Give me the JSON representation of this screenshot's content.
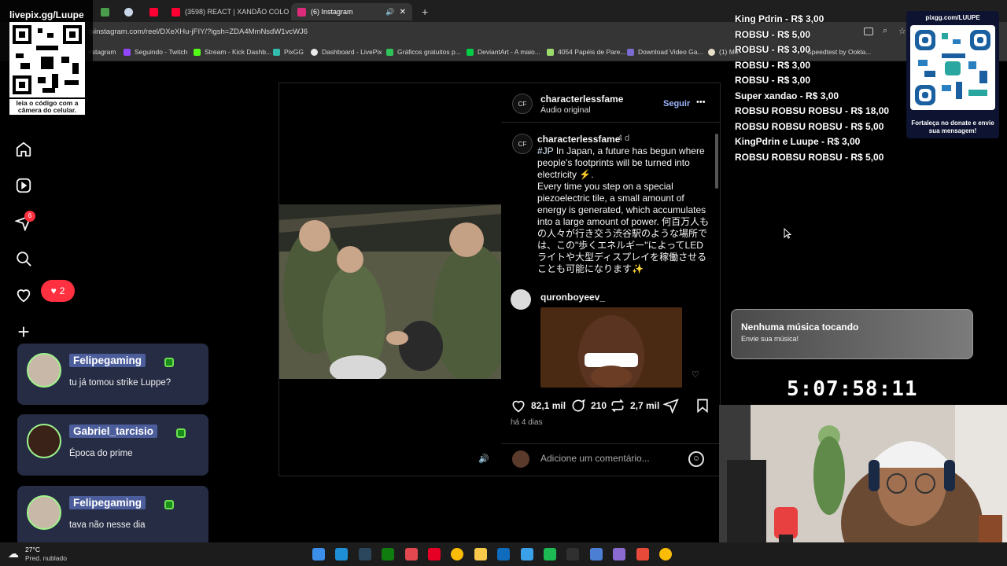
{
  "browser": {
    "tabs": [
      {
        "label": "livepix.gg/Luupe",
        "color": "#7ab8ff"
      },
      {
        "label": "",
        "color": "#4a9d4a"
      },
      {
        "label": "",
        "color": "#c8d6e8"
      },
      {
        "label": "",
        "color": "#ff0033"
      },
      {
        "label": "(3598) REACT | XANDÃO COLO",
        "color": "#ff0033"
      },
      {
        "label": "(6) Instagram",
        "color": "#dd2a7b"
      }
    ],
    "new_tab_label": "+",
    "url": "instagram.com/reel/DXeXHu-jFIY/?igsh=ZDA4MmNsdW1vcWJ6",
    "bookmarks": [
      {
        "label": "nstagram",
        "color": "#dd2a7b"
      },
      {
        "label": "Seguindo - Twitch",
        "color": "#9146ff"
      },
      {
        "label": "Stream - Kick Dashb...",
        "color": "#53fc18"
      },
      {
        "label": "PixGG",
        "color": "#32bcad"
      },
      {
        "label": "Dashboard - LivePix",
        "color": "#eaeaea"
      },
      {
        "label": "Gráficos gratuitos p...",
        "color": "#2ec45a"
      },
      {
        "label": "DeviantArt - A maio...",
        "color": "#05cc47"
      },
      {
        "label": "4054 Papéis de Pare...",
        "color": "#9adb6b"
      },
      {
        "label": "Download Video Ga...",
        "color": "#7a6bd1"
      },
      {
        "label": "(1) Me",
        "color": "#e8e0c8"
      },
      {
        "label": "Speedtest by Ookla...",
        "color": "#141526"
      }
    ]
  },
  "instagram": {
    "notifications_badge": "6",
    "likes_pill": "2",
    "post": {
      "author": "characterlessfame",
      "audio": "Áudio original",
      "follow": "Seguir",
      "more": "•••",
      "caption_author": "characterlessfame",
      "caption_age": "4 d",
      "caption_tag": "#JP",
      "caption_lines": [
        "In Japan, a future has begun where people's footprints will be turned into electricity ⚡.",
        "Every time you step on a special piezoelectric tile, a small amount of energy is generated, which accumulates into a large amount of power. 何百万人もの人々が行き交う渋谷駅のような場所では、この\"歩くエネルギー\"によってLEDライトや大型ディスプレイを稼働させることも可能になります✨"
      ],
      "commenter": "quronboyeev_",
      "likes": "82,1 mil",
      "comments": "210",
      "shares": "2,7 mil",
      "time": "há 4 dias",
      "comment_placeholder": "Adicione um comentário...",
      "avatar_initials": "CF"
    }
  },
  "stream": {
    "qr_left_top": "livepix.gg/Luupe",
    "qr_left_bottom": "leia o código com a câmera do celular.",
    "qr_right_top": "pixgg.com/LUUPE",
    "qr_right_bottom": "Fortaleça no donate e envie sua mensagem!",
    "donations": [
      "King Pdrin - R$ 3,00",
      "ROBSU - R$ 5,00",
      "ROBSU - R$ 3,00",
      "ROBSU - R$ 3,00",
      "ROBSU - R$ 3,00",
      "Super xandao - R$ 3,00",
      "ROBSU ROBSU ROBSU - R$ 18,00",
      "ROBSU ROBSU ROBSU - R$ 5,00",
      "KingPdrin e Luupe - R$ 3,00",
      "ROBSU ROBSU ROBSU - R$ 5,00"
    ],
    "music_title": "Nenhuma música tocando",
    "music_sub": "Envie sua música!",
    "timer": "5:07:58:11",
    "chat": [
      {
        "name": "Felipegaming",
        "message": "tu já tomou strike Luppe?"
      },
      {
        "name": "Gabriel_tarcisio",
        "message": "Época do prime"
      },
      {
        "name": "Felipegaming",
        "message": "tava não nesse dia"
      }
    ]
  },
  "taskbar": {
    "weather_temp": "27°C",
    "weather_desc": "Pred. nublado",
    "apps": [
      {
        "name": "windows-start-icon",
        "color": "#3b8eea"
      },
      {
        "name": "edge-icon",
        "color": "#1e8fd6"
      },
      {
        "name": "steam-icon",
        "color": "#2a475e"
      },
      {
        "name": "xbox-icon",
        "color": "#107c10"
      },
      {
        "name": "adobe-icon",
        "color": "#e34850"
      },
      {
        "name": "pinterest-icon",
        "color": "#e60023"
      },
      {
        "name": "chrome-icon",
        "color": "#fbbc05"
      },
      {
        "name": "folder-icon",
        "color": "#f8c84a"
      },
      {
        "name": "azure-icon",
        "color": "#0f6cbd"
      },
      {
        "name": "notepad-icon",
        "color": "#3aa0e8"
      },
      {
        "name": "spotify-icon",
        "color": "#1db954"
      },
      {
        "name": "obs-icon",
        "color": "#303030"
      },
      {
        "name": "app-icon",
        "color": "#4a7fd4"
      },
      {
        "name": "app-icon-2",
        "color": "#8c6bd1"
      },
      {
        "name": "photos-icon",
        "color": "#e84a3a"
      },
      {
        "name": "chrome-active-icon",
        "color": "#fbbc05"
      }
    ]
  }
}
